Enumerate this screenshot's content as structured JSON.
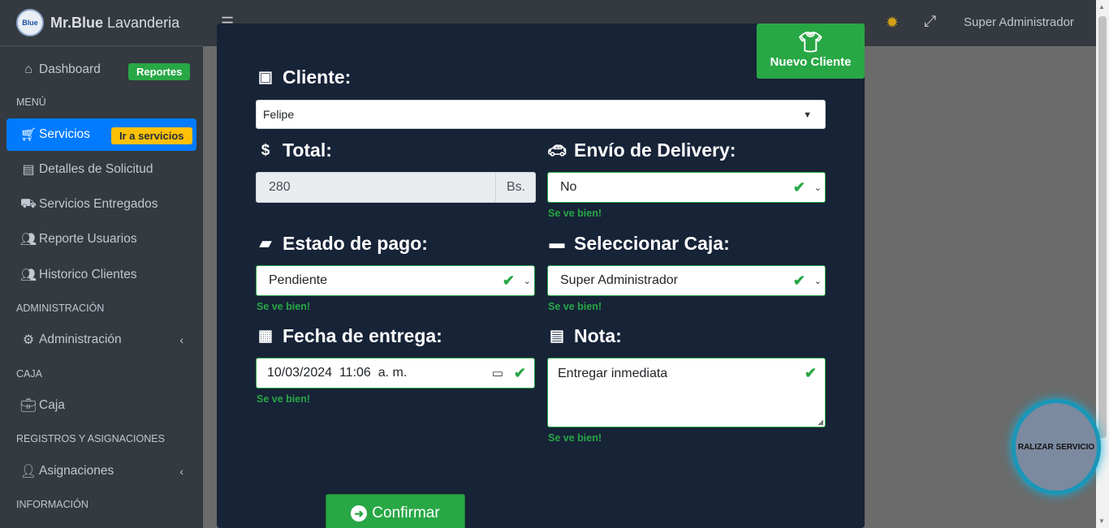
{
  "brand": {
    "logo_text": "Blue",
    "name_bold": "Mr.Blue",
    "name_rest": " Lavanderia"
  },
  "sidebar": {
    "dashboard": {
      "label": "Dashboard",
      "badge": "Reportes"
    },
    "header_menu": "MENÚ",
    "servicios": {
      "label": "Servicios",
      "badge": "Ir a servicios"
    },
    "detalles": "Detalles de Solicitud",
    "entregados": "Servicios Entregados",
    "reporte_usuarios": "Reporte Usuarios",
    "historico": "Historico Clientes",
    "header_admin": "ADMINISTRACIÓN",
    "administracion": "Administración",
    "header_caja": "CAJA",
    "caja": "Caja",
    "header_registros": "REGISTROS Y ASIGNACIONES",
    "asignaciones": "Asignaciones",
    "header_info": "INFORMACIÓN"
  },
  "topbar": {
    "user": "Super Administrador"
  },
  "float_button": "RALIZAR SERVICIO",
  "modal": {
    "new_client": "Nuevo Cliente",
    "cliente": {
      "label": "Cliente:",
      "value": "Felipe"
    },
    "total": {
      "label": "Total:",
      "value": "280",
      "addon": "Bs."
    },
    "delivery": {
      "label": "Envío de Delivery:",
      "value": "No",
      "valid": "Se ve bien!"
    },
    "estado_pago": {
      "label": "Estado de pago:",
      "value": "Pendiente",
      "valid": "Se ve bien!"
    },
    "caja": {
      "label": "Seleccionar Caja:",
      "value": "Super Administrador",
      "valid": "Se ve bien!"
    },
    "fecha": {
      "label": "Fecha de entrega:",
      "value": "10/03/2024  11:06  a. m.",
      "valid": "Se ve bien!"
    },
    "nota": {
      "label": "Nota:",
      "value": "Entregar inmediata",
      "valid": "Se ve bien!"
    },
    "confirm": "Confirmar"
  },
  "colors": {
    "primary": "#007bff",
    "success": "#28a745",
    "warning": "#ffc107",
    "modal_bg": "#172337",
    "sidebar_bg": "#343a40"
  }
}
